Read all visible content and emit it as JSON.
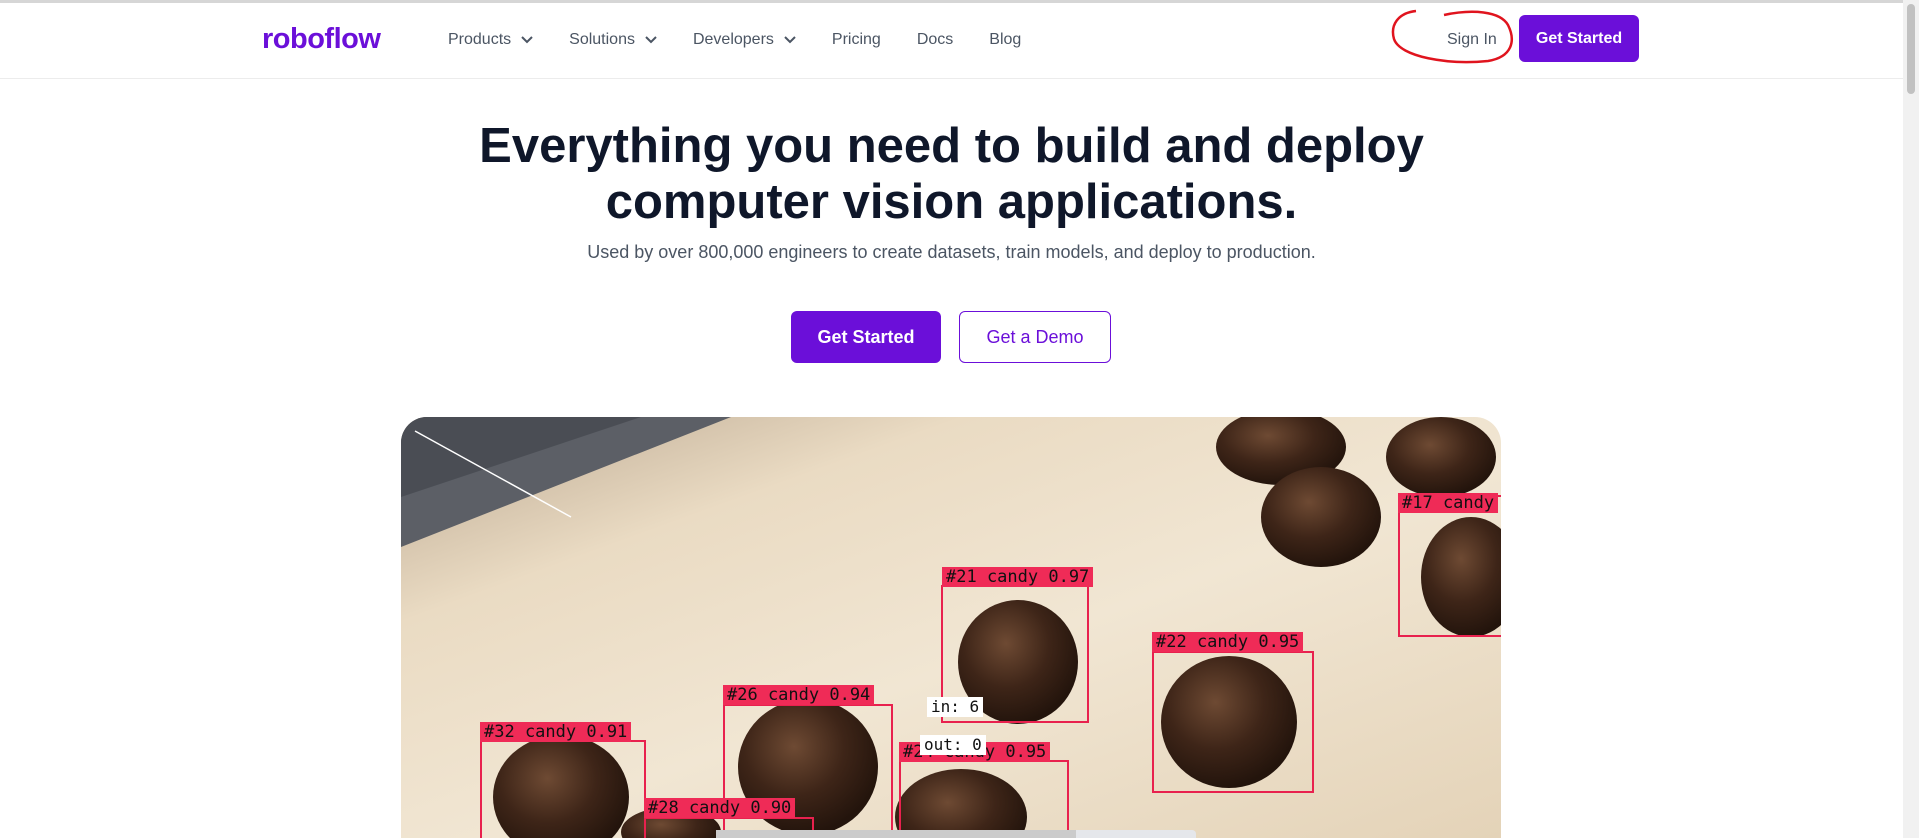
{
  "header": {
    "logo": "roboflow",
    "nav": [
      {
        "label": "Products",
        "has_dropdown": true
      },
      {
        "label": "Solutions",
        "has_dropdown": true
      },
      {
        "label": "Developers",
        "has_dropdown": true
      },
      {
        "label": "Pricing",
        "has_dropdown": false
      },
      {
        "label": "Docs",
        "has_dropdown": false
      },
      {
        "label": "Blog",
        "has_dropdown": false
      }
    ],
    "sign_in": "Sign In",
    "get_started": "Get Started"
  },
  "hero": {
    "title_line1": "Everything you need to build and deploy",
    "title_line2": "computer vision applications.",
    "subtitle": "Used by over 800,000 engineers to create datasets, train models, and deploy to production.",
    "cta_primary": "Get Started",
    "cta_secondary": "Get a Demo"
  },
  "media": {
    "detections": [
      {
        "label": "#17 candy"
      },
      {
        "label": "#21 candy 0.97"
      },
      {
        "label": "#22 candy 0.95"
      },
      {
        "label": "#26 candy 0.94"
      },
      {
        "label": "#32 candy 0.91"
      },
      {
        "label": "#24 candy 0.95"
      },
      {
        "label": "#28 candy 0.90"
      }
    ],
    "counter_in": "in: 6",
    "counter_out": "out: 0"
  },
  "colors": {
    "brand": "#6b0fd9",
    "detection": "#ef2b57",
    "annotation_circle": "#e0141e"
  }
}
